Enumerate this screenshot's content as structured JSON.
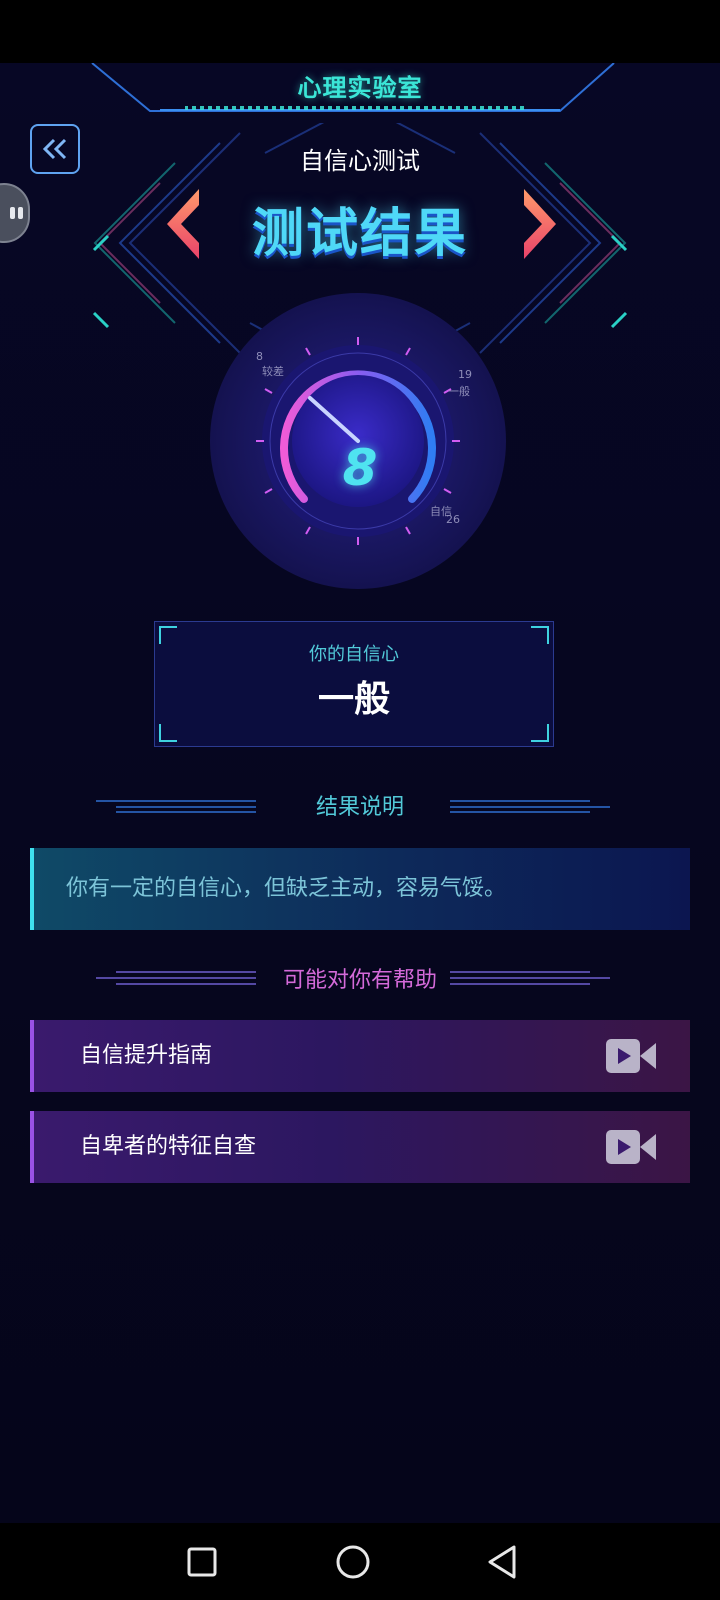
{
  "header": {
    "title": "心理实验室"
  },
  "test": {
    "name": "自信心测试",
    "result_title": "测试结果"
  },
  "gauge": {
    "score": "8",
    "labels": [
      {
        "value": "8",
        "text": "较差"
      },
      {
        "value": "19",
        "text": "一般"
      },
      {
        "value": "26",
        "text": "自信"
      }
    ]
  },
  "summary": {
    "label": "你的自信心",
    "value": "一般"
  },
  "explanation": {
    "title": "结果说明",
    "text": "你有一定的自信心，但缺乏主动，容易气馁。"
  },
  "help": {
    "title": "可能对你有帮助",
    "items": [
      {
        "label": "自信提升指南",
        "icon": "video-icon"
      },
      {
        "label": "自卑者的特征自查",
        "icon": "video-icon"
      }
    ]
  },
  "colors": {
    "background": "#06061f",
    "accent_cyan": "#3be6d7",
    "title_blue": "#4fd8f7",
    "gauge_pink": "#d15cf2",
    "help_purple": "#9a52e6"
  }
}
